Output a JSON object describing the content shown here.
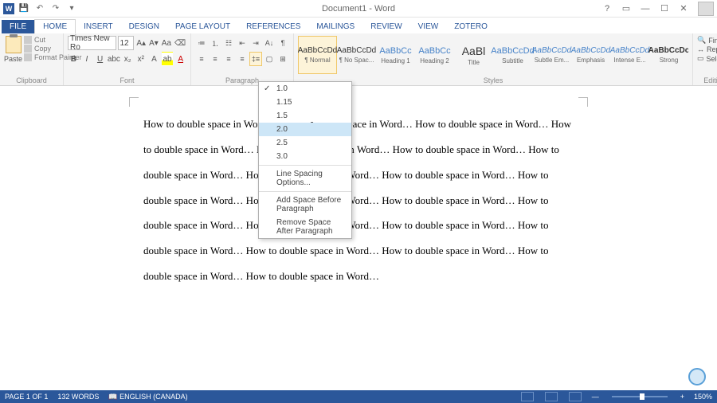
{
  "window": {
    "title": "Document1 - Word"
  },
  "qat": {
    "save": "💾",
    "undo": "↶",
    "redo": "↷"
  },
  "tabs": [
    "FILE",
    "HOME",
    "INSERT",
    "DESIGN",
    "PAGE LAYOUT",
    "REFERENCES",
    "MAILINGS",
    "REVIEW",
    "VIEW",
    "ZOTERO"
  ],
  "active_tab": "HOME",
  "clipboard": {
    "paste": "Paste",
    "cut": "Cut",
    "copy": "Copy",
    "painter": "Format Painter",
    "label": "Clipboard"
  },
  "font": {
    "family": "Times New Ro",
    "size": "12",
    "label": "Font"
  },
  "paragraph": {
    "label": "Paragraph"
  },
  "linespacing": {
    "options": [
      "1.0",
      "1.15",
      "1.5",
      "2.0",
      "2.5",
      "3.0"
    ],
    "checked": "1.0",
    "hovered": "2.0",
    "opts_label": "Line Spacing Options...",
    "add_before": "Add Space Before Paragraph",
    "remove_after": "Remove Space After Paragraph"
  },
  "styles": {
    "label": "Styles",
    "items": [
      {
        "preview": "AaBbCcDd",
        "name": "¶ Normal",
        "cls": "",
        "sel": true
      },
      {
        "preview": "AaBbCcDd",
        "name": "¶ No Spac...",
        "cls": ""
      },
      {
        "preview": "AaBbCc",
        "name": "Heading 1",
        "cls": "blue"
      },
      {
        "preview": "AaBbCc",
        "name": "Heading 2",
        "cls": "blue"
      },
      {
        "preview": "AaBl",
        "name": "Title",
        "cls": "big"
      },
      {
        "preview": "AaBbCcDd",
        "name": "Subtitle",
        "cls": "blue"
      },
      {
        "preview": "AaBbCcDd",
        "name": "Subtle Em...",
        "cls": "italic"
      },
      {
        "preview": "AaBbCcDd",
        "name": "Emphasis",
        "cls": "italic"
      },
      {
        "preview": "AaBbCcDd",
        "name": "Intense E...",
        "cls": "italic"
      },
      {
        "preview": "AaBbCcDc",
        "name": "Strong",
        "cls": "bold"
      }
    ]
  },
  "editing": {
    "find": "Find",
    "replace": "Replace",
    "select": "Select",
    "label": "Editing"
  },
  "document": {
    "text": "How to double space in Word… How to double space in Word… How to double space in Word… How to double space in Word… How to double space in Word… How to double space in Word… How to double space in Word… How to double space in Word… How to double space in Word… How to double space in Word… How to double space in Word… How to double space in Word… How to double space in Word… How to double space in Word… How to double space in Word… How to double space in Word… How to double space in Word… How to double space in Word… How to double space in Word… How to double space in Word…"
  },
  "status": {
    "page": "PAGE 1 OF 1",
    "words": "132 WORDS",
    "lang": "ENGLISH (CANADA)",
    "zoom": "150%"
  }
}
